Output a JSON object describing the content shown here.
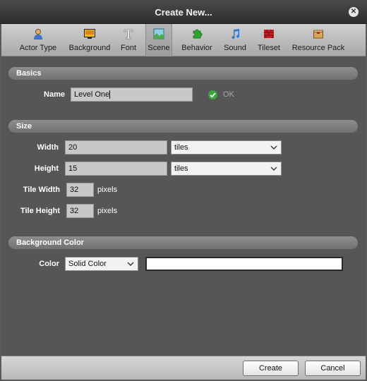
{
  "window": {
    "title": "Create New..."
  },
  "toolbar": {
    "items": [
      {
        "label": "Actor Type",
        "icon": "actor-icon"
      },
      {
        "label": "Background",
        "icon": "background-icon"
      },
      {
        "label": "Font",
        "icon": "font-icon"
      },
      {
        "label": "Scene",
        "icon": "scene-icon",
        "active": true
      },
      {
        "label": "Behavior",
        "icon": "behavior-icon"
      },
      {
        "label": "Sound",
        "icon": "sound-icon"
      },
      {
        "label": "Tileset",
        "icon": "tileset-icon"
      },
      {
        "label": "Resource Pack",
        "icon": "resource-pack-icon"
      }
    ]
  },
  "basics": {
    "header": "Basics",
    "name_label": "Name",
    "name_value": "Level One",
    "status_text": "OK",
    "status_color": "#3aa53a"
  },
  "size": {
    "header": "Size",
    "width_label": "Width",
    "width_value": "20",
    "width_unit": "tiles",
    "height_label": "Height",
    "height_value": "15",
    "height_unit": "tiles",
    "tile_width_label": "Tile Width",
    "tile_width_value": "32",
    "tile_width_unit": "pixels",
    "tile_height_label": "Tile Height",
    "tile_height_value": "32",
    "tile_height_unit": "pixels"
  },
  "background_color": {
    "header": "Background Color",
    "color_label": "Color",
    "color_mode": "Solid Color",
    "color_value": "#ffffff"
  },
  "footer": {
    "create_label": "Create",
    "cancel_label": "Cancel"
  }
}
